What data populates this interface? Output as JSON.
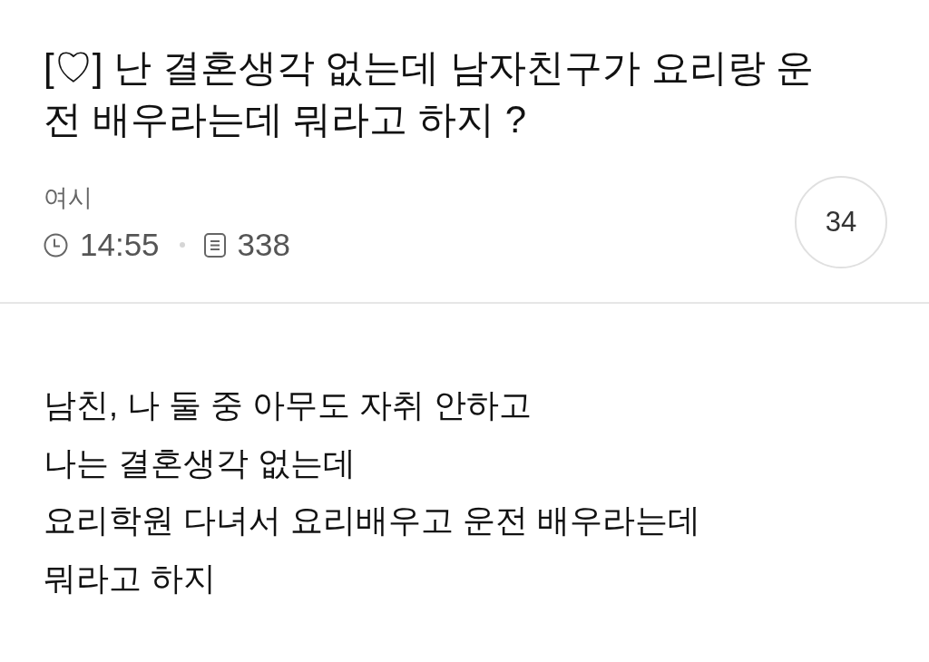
{
  "post": {
    "title": "[♡] 난 결혼생각 없는데 남자친구가 요리랑 운전 배우라는데 뭐라고 하지 ?",
    "author": "여시",
    "time": "14:55",
    "views": "338",
    "comment_count": "34"
  },
  "body": {
    "lines": [
      "남친, 나 둘 중 아무도 자취 안하고",
      "나는 결혼생각 없는데",
      "요리학원 다녀서 요리배우고 운전 배우라는데",
      "뭐라고 하지"
    ]
  }
}
